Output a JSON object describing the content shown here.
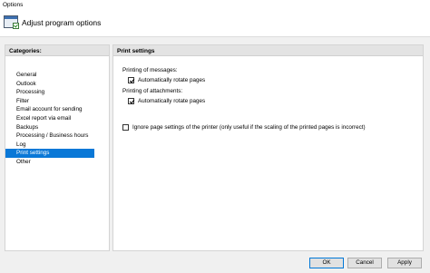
{
  "window": {
    "title": "Options"
  },
  "header": {
    "title": "Adjust program options",
    "icon": "settings-window-icon"
  },
  "categories": {
    "heading": "Categories:",
    "items": [
      {
        "label": "General"
      },
      {
        "label": "Outlook"
      },
      {
        "label": "Processing"
      },
      {
        "label": "Filter"
      },
      {
        "label": "Email account for sending"
      },
      {
        "label": "Excel report via email"
      },
      {
        "label": "Backups"
      },
      {
        "label": "Processing / Business hours"
      },
      {
        "label": "Log"
      },
      {
        "label": "Print settings",
        "selected": true
      },
      {
        "label": "Other"
      }
    ]
  },
  "print_settings": {
    "heading": "Print settings",
    "messages_label": "Printing of messages:",
    "messages_rotate": {
      "label": "Automatically rotate pages",
      "checked": true
    },
    "attachments_label": "Printing of attachments:",
    "attachments_rotate": {
      "label": "Automatically rotate pages",
      "checked": true
    },
    "ignore_printer": {
      "label": "Ignore page settings of the printer (only useful if the scaling of the printed pages is incorrect)",
      "checked": false
    }
  },
  "buttons": {
    "ok": "OK",
    "cancel": "Cancel",
    "apply": "Apply"
  },
  "colors": {
    "selection": "#0a78d7",
    "panel_header": "#e3e3e3",
    "dialog_bg": "#f0f0f0"
  }
}
